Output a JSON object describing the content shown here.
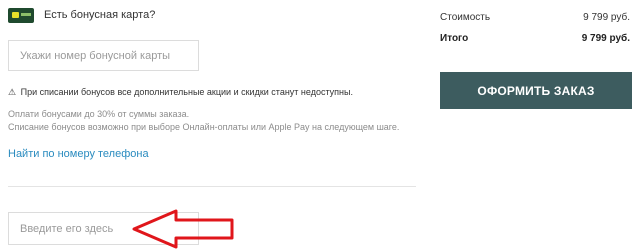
{
  "bonus": {
    "question": "Есть бонусная карта?",
    "card_input_placeholder": "Укажи номер бонусной карты",
    "warning_icon": "⚠",
    "warning_text": "При списании бонусов все дополнительные акции и скидки станут недоступны.",
    "note_line1": "Оплати бонусами до 30% от суммы заказа.",
    "note_line2": "Списание бонусов возможно при выборе Онлайн-оплаты или Apple Pay на следующем шаге.",
    "phone_link": "Найти по номеру телефона",
    "code_input_placeholder": "Введите его здесь"
  },
  "summary": {
    "cost_label": "Стоимость",
    "cost_value": "9 799 руб.",
    "total_label": "Итого",
    "total_value": "9 799 руб.",
    "checkout_label": "ОФОРМИТЬ ЗАКАЗ"
  },
  "colors": {
    "checkout_button": "#3d5c5f",
    "link": "#2a8bbf",
    "arrow": "#e0161b"
  },
  "icons": {
    "bonus_card": "bonus-card-icon",
    "warning": "warning-icon",
    "annotation": "red-arrow-icon"
  }
}
